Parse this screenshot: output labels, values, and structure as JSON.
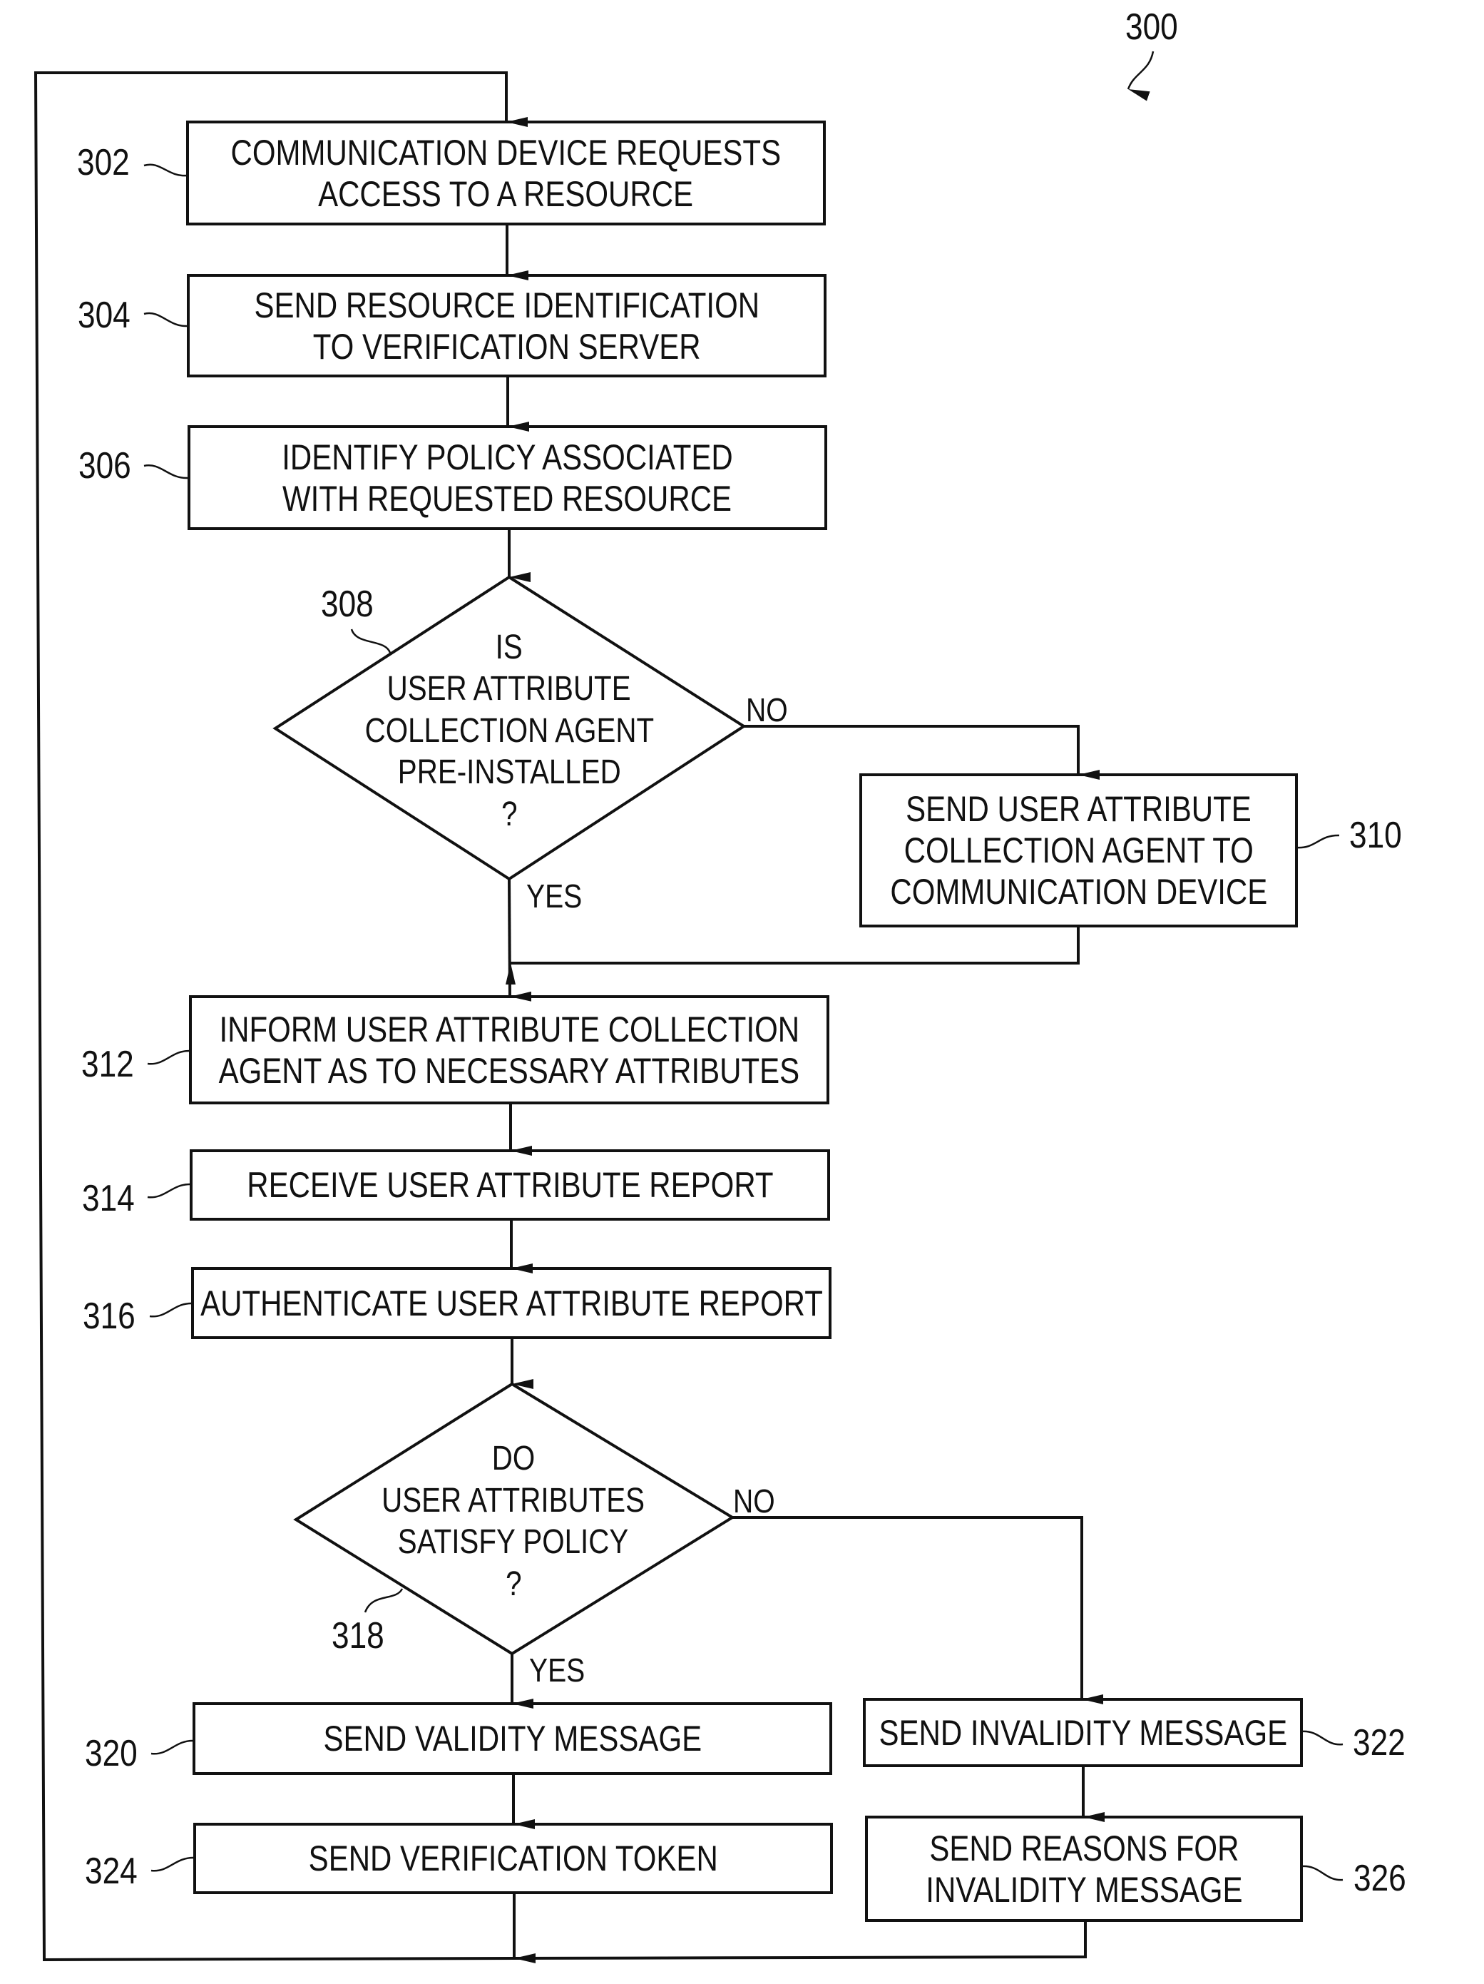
{
  "figure": {
    "number": "300",
    "steps": [
      {
        "id": "302",
        "type": "process",
        "lines": [
          "COMMUNICATION DEVICE REQUESTS",
          "ACCESS TO A RESOURCE"
        ]
      },
      {
        "id": "304",
        "type": "process",
        "lines": [
          "SEND RESOURCE IDENTIFICATION",
          "TO VERIFICATION SERVER"
        ]
      },
      {
        "id": "306",
        "type": "process",
        "lines": [
          "IDENTIFY POLICY ASSOCIATED",
          "WITH REQUESTED RESOURCE"
        ]
      },
      {
        "id": "308",
        "type": "decision",
        "lines": [
          "IS",
          "USER ATTRIBUTE",
          "COLLECTION AGENT",
          "PRE-INSTALLED",
          "?"
        ],
        "yes_label": "YES",
        "no_label": "NO"
      },
      {
        "id": "310",
        "type": "process",
        "lines": [
          "SEND USER ATTRIBUTE",
          "COLLECTION AGENT TO",
          "COMMUNICATION DEVICE"
        ]
      },
      {
        "id": "312",
        "type": "process",
        "lines": [
          "INFORM USER ATTRIBUTE COLLECTION",
          "AGENT AS TO NECESSARY ATTRIBUTES"
        ]
      },
      {
        "id": "314",
        "type": "process",
        "lines": [
          "RECEIVE USER ATTRIBUTE REPORT"
        ]
      },
      {
        "id": "316",
        "type": "process",
        "lines": [
          "AUTHENTICATE USER ATTRIBUTE REPORT"
        ]
      },
      {
        "id": "318",
        "type": "decision",
        "lines": [
          "DO",
          "USER ATTRIBUTES",
          "SATISFY POLICY",
          "?"
        ],
        "yes_label": "YES",
        "no_label": "NO"
      },
      {
        "id": "320",
        "type": "process",
        "lines": [
          "SEND VALIDITY MESSAGE"
        ]
      },
      {
        "id": "322",
        "type": "process",
        "lines": [
          "SEND INVALIDITY MESSAGE"
        ]
      },
      {
        "id": "324",
        "type": "process",
        "lines": [
          "SEND VERIFICATION TOKEN"
        ]
      },
      {
        "id": "326",
        "type": "process",
        "lines": [
          "SEND REASONS FOR",
          "INVALIDITY MESSAGE"
        ]
      }
    ]
  }
}
